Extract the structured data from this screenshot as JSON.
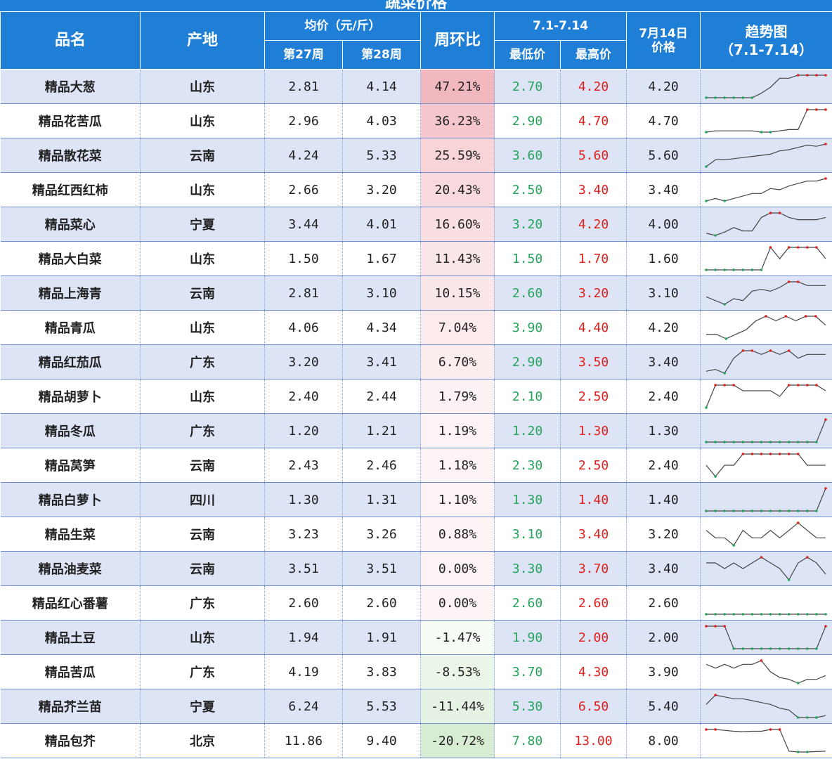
{
  "title": "蔬菜价格",
  "headers": {
    "name": "品名",
    "origin": "产地",
    "avg_group": "均价（元/斤）",
    "week27": "第27周",
    "week28": "第28周",
    "wow": "周环比",
    "range_group": "7.1-7.14",
    "min": "最低价",
    "max": "最高价",
    "price_line1": "7月14日",
    "price_line2": "价格",
    "trend_line1": "趋势图",
    "trend_line2": "（7.1-7.14）"
  },
  "colors": {
    "header_bg": "#1f7fd6",
    "row_alt": "#dde4f6",
    "low": "#25a35a",
    "high": "#e0201c",
    "increase_max": "#f2b8bf",
    "decrease_max": "#d7ecd3"
  },
  "rows": [
    {
      "name": "精品大葱",
      "origin": "山东",
      "w27": "2.81",
      "w28": "4.14",
      "wow": "47.21%",
      "wow_value": 47.21,
      "min": "2.70",
      "max": "4.20",
      "price": "4.20",
      "trend": [
        2.7,
        2.7,
        2.7,
        2.7,
        2.7,
        2.7,
        3.0,
        3.4,
        4.0,
        4.0,
        4.2,
        4.2,
        4.2,
        4.2
      ]
    },
    {
      "name": "精品花苦瓜",
      "origin": "山东",
      "w27": "2.96",
      "w28": "4.03",
      "wow": "36.23%",
      "wow_value": 36.23,
      "min": "2.90",
      "max": "4.70",
      "price": "4.70",
      "trend": [
        2.9,
        3.0,
        3.0,
        3.0,
        3.0,
        3.0,
        2.9,
        2.9,
        3.0,
        3.1,
        3.1,
        4.7,
        4.7,
        4.7
      ]
    },
    {
      "name": "精品散花菜",
      "origin": "云南",
      "w27": "4.24",
      "w28": "5.33",
      "wow": "25.59%",
      "wow_value": 25.59,
      "min": "3.60",
      "max": "5.60",
      "price": "5.60",
      "trend": [
        3.6,
        4.2,
        4.2,
        4.3,
        4.4,
        4.5,
        4.6,
        4.7,
        5.0,
        5.1,
        5.3,
        5.5,
        5.4,
        5.6
      ]
    },
    {
      "name": "精品红西红柿",
      "origin": "山东",
      "w27": "2.66",
      "w28": "3.20",
      "wow": "20.43%",
      "wow_value": 20.43,
      "min": "2.50",
      "max": "3.40",
      "price": "3.40",
      "trend": [
        2.5,
        2.6,
        2.5,
        2.6,
        2.7,
        2.8,
        2.8,
        3.0,
        2.95,
        3.1,
        3.2,
        3.3,
        3.3,
        3.4
      ]
    },
    {
      "name": "精品菜心",
      "origin": "宁夏",
      "w27": "3.44",
      "w28": "4.01",
      "wow": "16.60%",
      "wow_value": 16.6,
      "min": "3.20",
      "max": "4.20",
      "price": "4.00",
      "trend": [
        3.3,
        3.2,
        3.35,
        3.55,
        3.4,
        3.4,
        4.0,
        4.2,
        4.2,
        4.0,
        3.9,
        3.9,
        3.9,
        4.0
      ]
    },
    {
      "name": "精品大白菜",
      "origin": "山东",
      "w27": "1.50",
      "w28": "1.67",
      "wow": "11.43%",
      "wow_value": 11.43,
      "min": "1.50",
      "max": "1.70",
      "price": "1.60",
      "trend": [
        1.5,
        1.5,
        1.5,
        1.5,
        1.5,
        1.5,
        1.5,
        1.7,
        1.6,
        1.7,
        1.7,
        1.7,
        1.7,
        1.6
      ]
    },
    {
      "name": "精品上海青",
      "origin": "云南",
      "w27": "2.81",
      "w28": "3.10",
      "wow": "10.15%",
      "wow_value": 10.15,
      "min": "2.60",
      "max": "3.20",
      "price": "3.10",
      "trend": [
        2.8,
        2.7,
        2.6,
        2.75,
        2.7,
        2.95,
        3.0,
        2.95,
        3.05,
        3.2,
        3.2,
        3.1,
        3.1,
        3.1
      ]
    },
    {
      "name": "精品青瓜",
      "origin": "山东",
      "w27": "4.06",
      "w28": "4.34",
      "wow": "7.04%",
      "wow_value": 7.04,
      "min": "3.90",
      "max": "4.40",
      "price": "4.20",
      "trend": [
        4.0,
        4.0,
        3.9,
        4.0,
        4.1,
        4.3,
        4.4,
        4.3,
        4.4,
        4.3,
        4.4,
        4.4,
        4.2
      ]
    },
    {
      "name": "精品红茄瓜",
      "origin": "广东",
      "w27": "3.20",
      "w28": "3.41",
      "wow": "6.70%",
      "wow_value": 6.7,
      "min": "2.90",
      "max": "3.50",
      "price": "3.40",
      "trend": [
        2.95,
        3.0,
        2.9,
        3.3,
        3.5,
        3.5,
        3.4,
        3.5,
        3.4,
        3.5,
        3.3,
        3.4,
        3.4,
        3.4
      ]
    },
    {
      "name": "精品胡萝卜",
      "origin": "山东",
      "w27": "2.40",
      "w28": "2.44",
      "wow": "1.79%",
      "wow_value": 1.79,
      "min": "2.10",
      "max": "2.50",
      "price": "2.40",
      "trend": [
        2.1,
        2.5,
        2.5,
        2.5,
        2.4,
        2.4,
        2.4,
        2.4,
        2.3,
        2.5,
        2.5,
        2.5,
        2.5,
        2.4
      ]
    },
    {
      "name": "精品冬瓜",
      "origin": "广东",
      "w27": "1.20",
      "w28": "1.21",
      "wow": "1.19%",
      "wow_value": 1.19,
      "min": "1.20",
      "max": "1.30",
      "price": "1.30",
      "trend": [
        1.2,
        1.2,
        1.2,
        1.2,
        1.2,
        1.2,
        1.2,
        1.2,
        1.2,
        1.2,
        1.2,
        1.2,
        1.2,
        1.3
      ]
    },
    {
      "name": "精品莴笋",
      "origin": "云南",
      "w27": "2.43",
      "w28": "2.46",
      "wow": "1.18%",
      "wow_value": 1.18,
      "min": "2.30",
      "max": "2.50",
      "price": "2.40",
      "trend": [
        2.4,
        2.3,
        2.4,
        2.4,
        2.5,
        2.5,
        2.5,
        2.5,
        2.5,
        2.5,
        2.5,
        2.4,
        2.4,
        2.4
      ]
    },
    {
      "name": "精品白萝卜",
      "origin": "四川",
      "w27": "1.30",
      "w28": "1.31",
      "wow": "1.10%",
      "wow_value": 1.1,
      "min": "1.30",
      "max": "1.40",
      "price": "1.40",
      "trend": [
        1.3,
        1.3,
        1.3,
        1.3,
        1.3,
        1.3,
        1.3,
        1.3,
        1.3,
        1.3,
        1.3,
        1.3,
        1.3,
        1.4
      ]
    },
    {
      "name": "精品生菜",
      "origin": "云南",
      "w27": "3.23",
      "w28": "3.26",
      "wow": "0.88%",
      "wow_value": 0.88,
      "min": "3.10",
      "max": "3.40",
      "price": "3.20",
      "trend": [
        3.3,
        3.2,
        3.2,
        3.1,
        3.3,
        3.2,
        3.2,
        3.3,
        3.2,
        3.3,
        3.4,
        3.3,
        3.2,
        3.2
      ]
    },
    {
      "name": "精品油麦菜",
      "origin": "云南",
      "w27": "3.51",
      "w28": "3.51",
      "wow": "0.00%",
      "wow_value": 0.0,
      "min": "3.30",
      "max": "3.70",
      "price": "3.40",
      "trend": [
        3.6,
        3.6,
        3.5,
        3.6,
        3.5,
        3.6,
        3.7,
        3.6,
        3.5,
        3.3,
        3.6,
        3.7,
        3.6,
        3.4
      ]
    },
    {
      "name": "精品红心番薯",
      "origin": "广东",
      "w27": "2.60",
      "w28": "2.60",
      "wow": "0.00%",
      "wow_value": 0.0,
      "min": "2.60",
      "max": "2.60",
      "price": "2.60",
      "trend": [
        2.6,
        2.6,
        2.6,
        2.6,
        2.6,
        2.6,
        2.6,
        2.6,
        2.6,
        2.6,
        2.6,
        2.6,
        2.6,
        2.6
      ]
    },
    {
      "name": "精品土豆",
      "origin": "山东",
      "w27": "1.94",
      "w28": "1.91",
      "wow": "-1.47%",
      "wow_value": -1.47,
      "min": "1.90",
      "max": "2.00",
      "price": "2.00",
      "trend": [
        2.0,
        2.0,
        2.0,
        1.9,
        1.9,
        1.9,
        1.9,
        1.9,
        1.9,
        1.9,
        1.9,
        1.9,
        1.9,
        2.0
      ]
    },
    {
      "name": "精品苦瓜",
      "origin": "广东",
      "w27": "4.19",
      "w28": "3.83",
      "wow": "-8.53%",
      "wow_value": -8.53,
      "min": "3.70",
      "max": "4.30",
      "price": "3.90",
      "trend": [
        4.2,
        4.1,
        4.2,
        4.1,
        4.2,
        4.2,
        4.3,
        4.0,
        3.85,
        3.8,
        3.7,
        3.8,
        3.8,
        3.9
      ]
    },
    {
      "name": "精品芥兰苗",
      "origin": "宁夏",
      "w27": "6.24",
      "w28": "5.53",
      "wow": "-11.44%",
      "wow_value": -11.44,
      "min": "5.30",
      "max": "6.50",
      "price": "5.40",
      "trend": [
        6.0,
        6.5,
        6.4,
        6.3,
        6.3,
        6.2,
        6.1,
        6.0,
        5.8,
        5.7,
        5.3,
        5.3,
        5.3,
        5.4
      ]
    },
    {
      "name": "精品包芥",
      "origin": "北京",
      "w27": "11.86",
      "w28": "9.40",
      "wow": "-20.72%",
      "wow_value": -20.72,
      "min": "7.80",
      "max": "13.00",
      "price": "8.00",
      "trend": [
        13.0,
        13.0,
        12.8,
        12.6,
        12.5,
        12.6,
        12.6,
        13.0,
        13.0,
        8.0,
        7.8,
        7.8,
        7.9,
        8.0
      ]
    }
  ]
}
